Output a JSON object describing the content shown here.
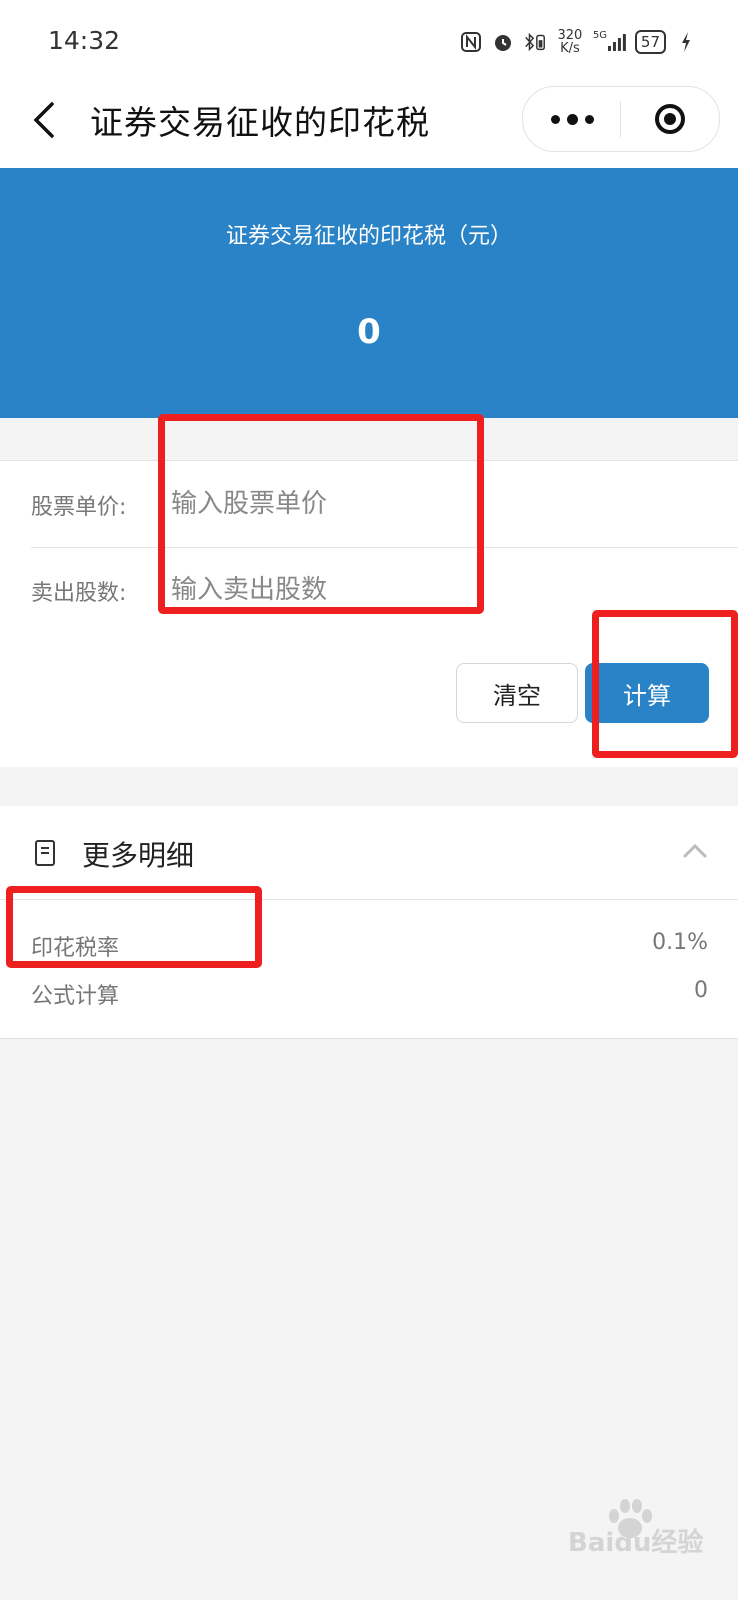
{
  "status_bar": {
    "time": "14:32",
    "network_speed_value": "320",
    "network_speed_unit": "K/s",
    "signal_label": "5G",
    "battery": "57"
  },
  "nav": {
    "title": "证券交易征收的印花税"
  },
  "result": {
    "label": "证券交易征收的印花税（元）",
    "value": "0"
  },
  "form": {
    "price_label": "股票单价:",
    "price_placeholder": "输入股票单价",
    "shares_label": "卖出股数:",
    "shares_placeholder": "输入卖出股数"
  },
  "buttons": {
    "clear": "清空",
    "calculate": "计算"
  },
  "details": {
    "title": "更多明细",
    "rows": [
      {
        "label": "印花税率",
        "value": "0.1%"
      },
      {
        "label": "公式计算",
        "value": "0"
      }
    ]
  },
  "watermark": {
    "text": "Baidu经验"
  },
  "colors": {
    "primary": "#2a83c7",
    "annotation": "#ee1f1f",
    "background": "#f4f4f4"
  }
}
